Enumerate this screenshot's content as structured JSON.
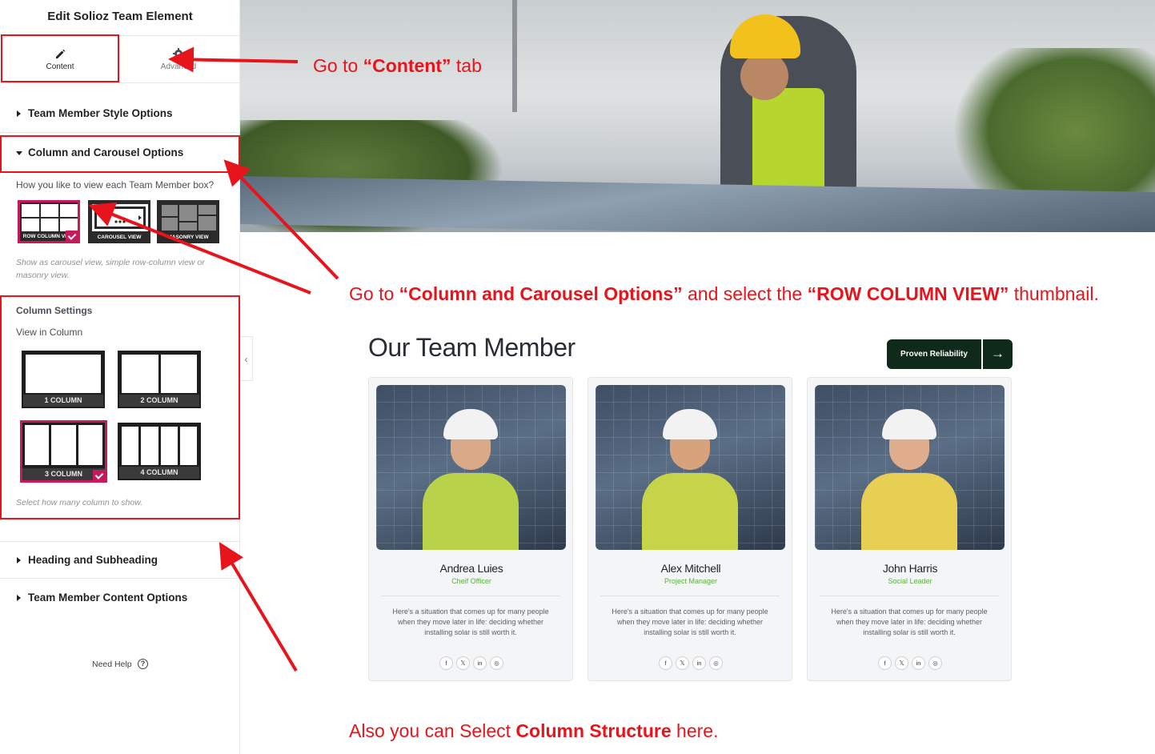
{
  "panel": {
    "title": "Edit Solioz Team Element",
    "tabs": [
      {
        "label": "Content",
        "icon": "pencil-icon"
      },
      {
        "label": "Advanced",
        "icon": "gear-icon"
      }
    ],
    "sections": {
      "style": "Team Member Style Options",
      "carousel": "Column and Carousel Options",
      "heading": "Heading and Subheading",
      "content": "Team Member Content Options"
    },
    "view_question": "How you like to view each Team Member box?",
    "view_options": [
      "ROW COLUMN VIEW",
      "CAROUSEL VIEW",
      "MASONRY VIEW"
    ],
    "view_desc": "Show as carousel view, simple row-column view or masonry view.",
    "column_settings": "Column Settings",
    "view_in_column": "View in Column",
    "column_options": [
      "1 COLUMN",
      "2 COLUMN",
      "3 COLUMN",
      "4 COLUMN"
    ],
    "column_desc": "Select how many column to show.",
    "need_help": "Need Help",
    "help_glyph": "?",
    "collapse_glyph": "‹"
  },
  "annotations": {
    "content_tab": {
      "pre": "Go  to ",
      "bold": "“Content”",
      "post": " tab"
    },
    "carousel": {
      "pre": "Go to ",
      "bold1": "“Column and Carousel Options”",
      "mid": " and select the ",
      "bold2": "“ROW COLUMN VIEW”",
      "post": " thumbnail."
    },
    "structure": {
      "pre": "Also you can Select ",
      "bold": "Column Structure",
      "post": " here."
    }
  },
  "team": {
    "title": "Our Team Member",
    "cta_label": "Proven Reliability",
    "cta_arrow": "→",
    "members": [
      {
        "name": "Andrea Luies",
        "role": "Cheif Officer",
        "bio": "Here's a situation that comes up for many people when they move later in life: deciding whether installing solar is still worth it."
      },
      {
        "name": "Alex Mitchell",
        "role": "Project Manager",
        "bio": "Here's a situation that comes up for many people when they move later in life: deciding whether installing solar is still worth it."
      },
      {
        "name": "John Harris",
        "role": "Social Leader",
        "bio": "Here's a situation that comes up for many people when they move later in life: deciding whether installing solar is still worth it."
      }
    ],
    "social": [
      "f",
      "𝕏",
      "in",
      "◎"
    ]
  },
  "colors": {
    "highlight": "#e8141b",
    "selected": "#c8195d",
    "cta": "#0f2a1a",
    "role": "#58b03a"
  }
}
